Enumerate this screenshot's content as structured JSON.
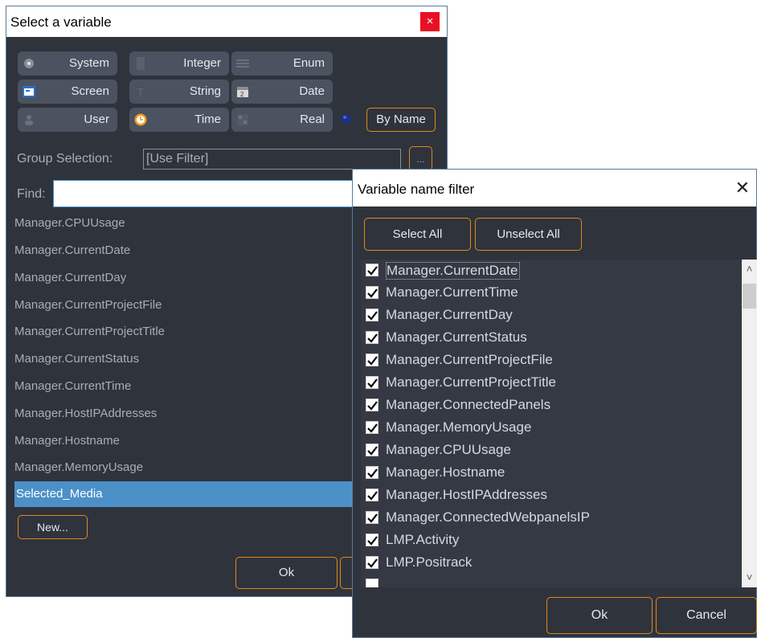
{
  "dialog1": {
    "title": "Select a variable",
    "close_glyph": "×",
    "type_buttons": [
      {
        "label": "System",
        "icon": "system-icon"
      },
      {
        "label": "Integer",
        "icon": "integer-icon"
      },
      {
        "label": "Enum",
        "icon": "enum-icon"
      },
      {
        "label": "Screen",
        "icon": "screen-icon"
      },
      {
        "label": "String",
        "icon": "string-icon"
      },
      {
        "label": "Date",
        "icon": "date-icon"
      },
      {
        "label": "User",
        "icon": "user-icon"
      },
      {
        "label": "Time",
        "icon": "clock-icon"
      },
      {
        "label": "Real",
        "icon": "real-icon"
      }
    ],
    "by_name_label": "By Name",
    "group_label": "Group Selection:",
    "group_value": "[Use Filter]",
    "group_browse": "...",
    "find_label": "Find:",
    "find_value": "",
    "items": [
      "Manager.CPUUsage",
      "Manager.CurrentDate",
      "Manager.CurrentDay",
      "Manager.CurrentProjectFile",
      "Manager.CurrentProjectTitle",
      "Manager.CurrentStatus",
      "Manager.CurrentTime",
      "Manager.HostIPAddresses",
      "Manager.Hostname",
      "Manager.MemoryUsage",
      "Selected_Media"
    ],
    "selected_index": 10,
    "new_label": "New...",
    "ok_label": "Ok"
  },
  "dialog2": {
    "title": "Variable name filter",
    "close_glyph": "✕",
    "select_all_label": "Select All",
    "unselect_all_label": "Unselect All",
    "rows": [
      {
        "label": "Manager.CurrentDate",
        "checked": true
      },
      {
        "label": "Manager.CurrentTime",
        "checked": true
      },
      {
        "label": "Manager.CurrentDay",
        "checked": true
      },
      {
        "label": "Manager.CurrentStatus",
        "checked": true
      },
      {
        "label": "Manager.CurrentProjectFile",
        "checked": true
      },
      {
        "label": "Manager.CurrentProjectTitle",
        "checked": true
      },
      {
        "label": "Manager.ConnectedPanels",
        "checked": true
      },
      {
        "label": "Manager.MemoryUsage",
        "checked": true
      },
      {
        "label": "Manager.CPUUsage",
        "checked": true
      },
      {
        "label": "Manager.Hostname",
        "checked": true
      },
      {
        "label": "Manager.HostIPAddresses",
        "checked": true
      },
      {
        "label": "Manager.ConnectedWebpanelsIP",
        "checked": true
      },
      {
        "label": "LMP.Activity",
        "checked": true
      },
      {
        "label": "LMP.Positrack",
        "checked": true
      }
    ],
    "ok_label": "Ok",
    "cancel_label": "Cancel"
  },
  "colors": {
    "accent_border": "#e08a1a",
    "dialog_bg": "#2f333c",
    "selection": "#4c90c8",
    "close_red": "#e81123"
  }
}
